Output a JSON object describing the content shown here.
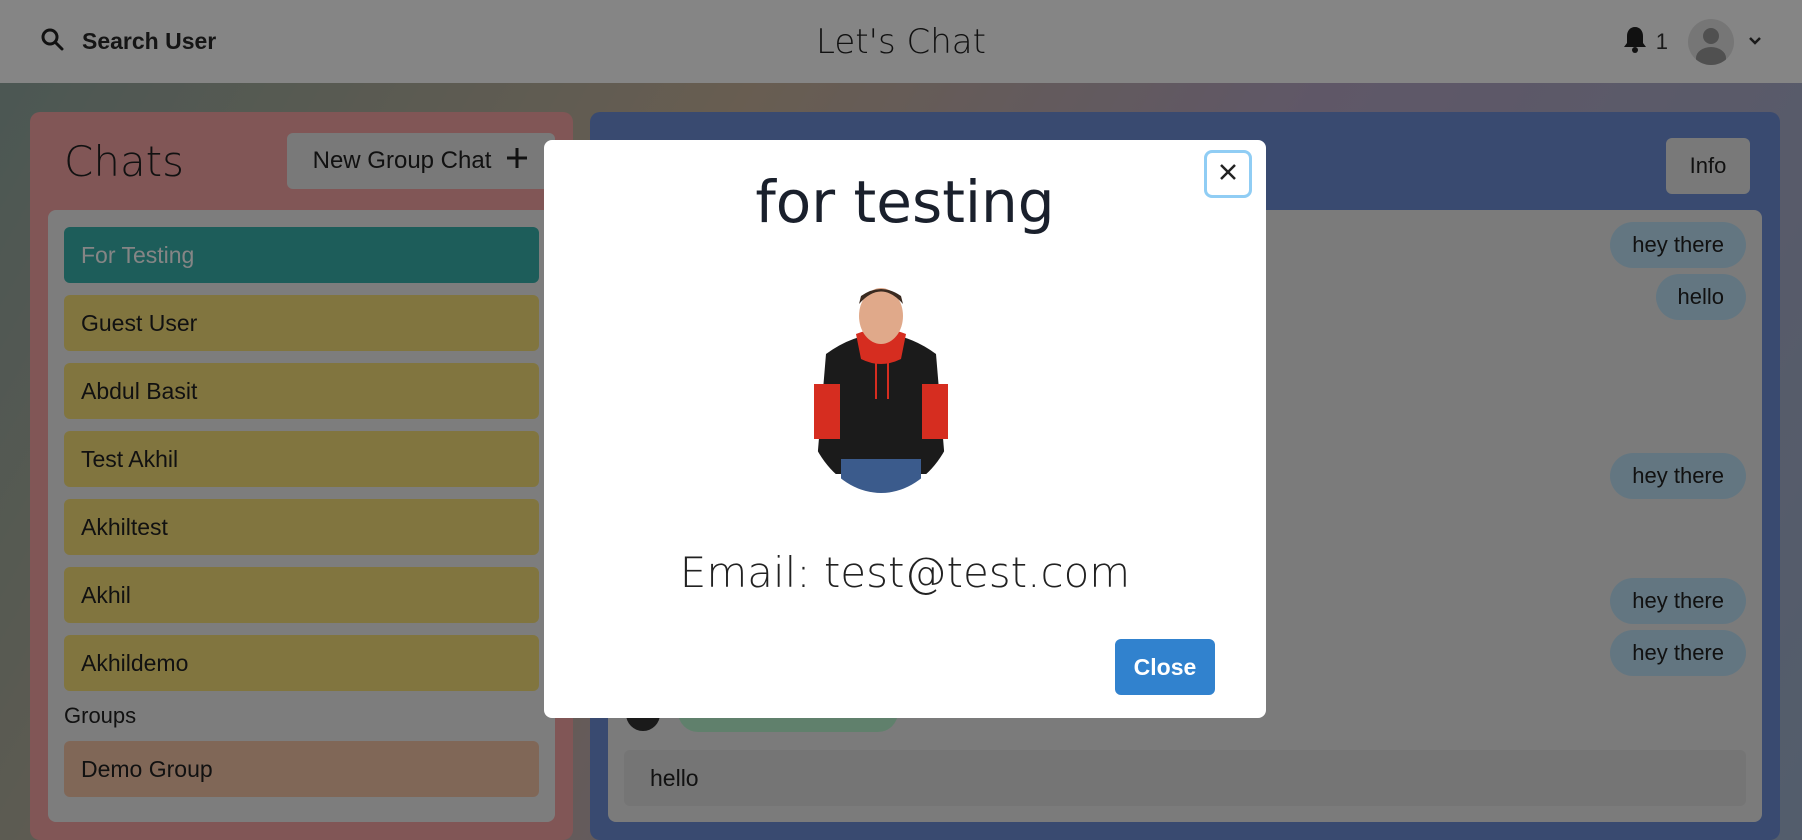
{
  "header": {
    "search_label": "Search User",
    "app_title": "Let's Chat",
    "notification_count": "1"
  },
  "sidebar": {
    "title": "Chats",
    "new_group_label": "New Group Chat",
    "chats": [
      {
        "label": "For Testing"
      },
      {
        "label": "Guest User"
      },
      {
        "label": "Abdul Basit"
      },
      {
        "label": "Test Akhil"
      },
      {
        "label": "Akhiltest"
      },
      {
        "label": "Akhil"
      },
      {
        "label": "Akhildemo"
      }
    ],
    "groups_label": "Groups",
    "groups": [
      {
        "label": "Demo Group"
      }
    ]
  },
  "chat": {
    "info_label": "Info",
    "messages": [
      {
        "text": "hey there"
      },
      {
        "text": "hello"
      },
      {
        "text": "hey there"
      },
      {
        "text": "hey there"
      },
      {
        "text": "hey there"
      }
    ],
    "input_value": "hello"
  },
  "modal": {
    "title": "for testing",
    "email_text": "Email: test@test.com",
    "close_label": "Close"
  },
  "colors": {
    "active_chat": "#38b2ac",
    "chat_item": "#f8e17a",
    "group_item": "#f6c6a8",
    "primary": "#3182ce",
    "bubble": "#bee3f8"
  }
}
